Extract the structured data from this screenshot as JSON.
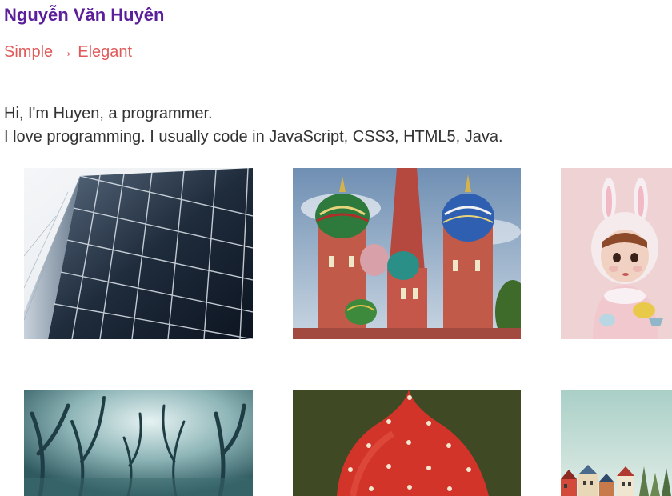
{
  "header": {
    "title": "Nguyễn Văn Huyên",
    "tagline": "Simple → Elegant"
  },
  "intro": {
    "line1": "Hi, I'm Huyen, a programmer.",
    "line2": "I love programming. I usually code in JavaScript, CSS3, HTML5, Java."
  },
  "colors": {
    "title": "#5b1f9a",
    "tagline": "#e05a5a",
    "body_text": "#333333"
  },
  "gallery": {
    "items": [
      {
        "subject": "glass-skyscraper-photo"
      },
      {
        "subject": "st-basils-cathedral-photo"
      },
      {
        "subject": "bunny-hat-girl-painting"
      },
      {
        "subject": "misty-forest-photo"
      },
      {
        "subject": "red-dotted-dome-painting"
      },
      {
        "subject": "village-houses-painting"
      }
    ]
  }
}
